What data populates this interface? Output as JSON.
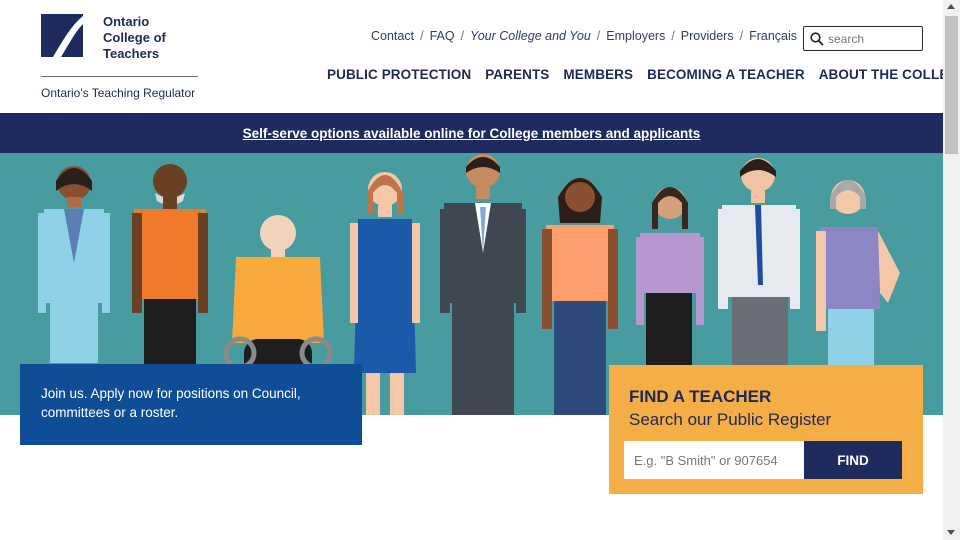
{
  "logo": {
    "name_line1": "Ontario",
    "name_line2": "College of",
    "name_line3": "Teachers",
    "tagline": "Ontario's Teaching Regulator",
    "mark_icon": "occt-logo-mark-icon"
  },
  "util_nav": [
    {
      "label": "Contact"
    },
    {
      "label": "FAQ"
    },
    {
      "label": "Your College and You"
    },
    {
      "label": "Employers"
    },
    {
      "label": "Providers"
    },
    {
      "label": "Français"
    }
  ],
  "util_separator": "/",
  "search": {
    "placeholder": "search",
    "icon": "search-icon"
  },
  "main_nav": [
    {
      "label": "PUBLIC PROTECTION"
    },
    {
      "label": "PARENTS"
    },
    {
      "label": "MEMBERS"
    },
    {
      "label": "BECOMING A TEACHER"
    },
    {
      "label": "ABOUT THE COLLEGE"
    }
  ],
  "banner": {
    "text": "Self-serve options available online for College members and applicants"
  },
  "callout": {
    "text": "Join us. Apply now for positions on Council, committees or a roster."
  },
  "find_teacher": {
    "title": "FIND A TEACHER",
    "subtitle": "Search our Public Register",
    "placeholder": "E.g. \"B Smith\" or 907654",
    "button": "FIND"
  },
  "colors": {
    "navy": "#1f2b5e",
    "teal": "#489b9f",
    "blue": "#0f4e97",
    "orange": "#f5ad46"
  }
}
